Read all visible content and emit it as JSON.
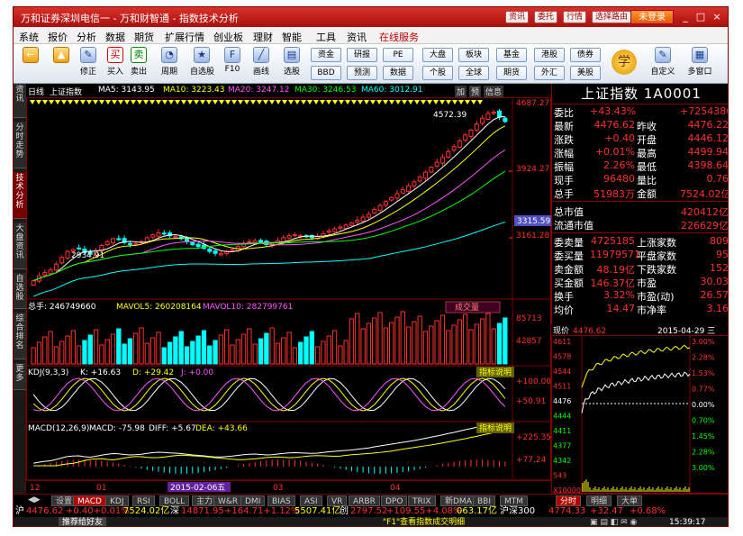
{
  "window": {
    "title": "万和证券深圳电信一 - 万和财智通 - 指数技术分析",
    "title_buttons": [
      "资讯",
      "委托",
      "行情",
      "选择路由"
    ],
    "login_button": "未登录",
    "controls": [
      "_",
      "□",
      "×"
    ]
  },
  "menu": [
    "系统",
    "报价",
    "分析",
    "数据",
    "期货",
    "扩展行情",
    "创业板",
    "理财",
    "智能",
    "工具",
    "资讯",
    "在线服务"
  ],
  "toolbar": {
    "tools": [
      {
        "label": "",
        "icon": "←"
      },
      {
        "label": "",
        "icon": "▲"
      },
      {
        "label": "修正",
        "icon": "✎"
      },
      {
        "label": "买入",
        "icon": "买"
      },
      {
        "label": "卖出",
        "icon": "卖"
      },
      {
        "label": "周期",
        "icon": "◔"
      },
      {
        "label": "自选股",
        "icon": "★"
      },
      {
        "label": "F10",
        "icon": "F"
      },
      {
        "label": "画线",
        "icon": "╱"
      },
      {
        "label": "选股",
        "icon": "▤"
      }
    ],
    "small_buttons": [
      [
        "资金",
        "BBD"
      ],
      [
        "研报",
        "预测"
      ],
      [
        "PE",
        "数据"
      ],
      [
        "大盘",
        "个股"
      ],
      [
        "板块",
        "全球"
      ],
      [
        "基金",
        "期货"
      ],
      [
        "港股",
        "外汇"
      ],
      [
        "债券",
        "美股"
      ]
    ],
    "study_label": "学",
    "custom_label": "自定义",
    "multiwin_label": "多窗口"
  },
  "left_tabs": [
    "资讯",
    "分时走势",
    "技术分析",
    "大盘资讯",
    "自选股",
    "综合排名",
    "更多"
  ],
  "left_tabs_active": 2,
  "main_info": {
    "period": "日线",
    "name": "上证指数",
    "ma5": "MA5: 3143.95",
    "ma10": "MA10: 3223.43",
    "ma20": "MA20: 3247.12",
    "ma30": "MA30: 3246.53",
    "ma60": "MA60: 3012.91",
    "buttons": [
      "加",
      "预",
      "信息"
    ],
    "high_label": "4572.39",
    "low_label": "2934.91"
  },
  "volume_info": {
    "total": "总手: 246749660",
    "mavol5": "MAVOL5: 260208164",
    "mavol10": "MAVOL10: 282799761",
    "button": "成交量"
  },
  "kdj_info": {
    "name": "KDJ(9,3,3)",
    "k": "K: +16.63",
    "d": "D: +29.42",
    "j": "J: +0.00",
    "button": "指标说明"
  },
  "macd_info": {
    "name": "MACD(12,26,9)",
    "macd": "MACD: -75.98",
    "diff": "DIFF: +5.67",
    "dea": "DEA: +43.66",
    "button": "指标说明"
  },
  "axis": {
    "price": [
      "4687.27",
      "3924.27",
      "3161.28"
    ],
    "cursor": "3315.59",
    "volume": [
      "85713",
      "42857"
    ],
    "kdj": [
      "+100.00",
      "+50.91"
    ],
    "macd": [
      "+225.35",
      "+77.24"
    ],
    "x_labels": [
      "12",
      "01",
      "2015-02-06五",
      "03",
      "04"
    ]
  },
  "chart_data": {
    "type": "candlestick",
    "title": "上证指数",
    "x_ticks": [
      "12",
      "01",
      "2015-02-06五",
      "03",
      "04"
    ],
    "ylim": [
      2700,
      4687.27
    ],
    "y_ticks": [
      4687.27,
      3924.27,
      3161.28
    ],
    "low_marker": 2934.91,
    "high_marker": 4572.39,
    "cursor_value": 3315.59,
    "close_series": [
      2850,
      2900,
      2934.91,
      2960,
      3020,
      3090,
      3150,
      3170,
      3180,
      3140,
      3120,
      3160,
      3210,
      3250,
      3280,
      3270,
      3240,
      3220,
      3230,
      3250,
      3290,
      3320,
      3340,
      3330,
      3310,
      3300,
      3280,
      3250,
      3220,
      3200,
      3180,
      3150,
      3130,
      3130,
      3150,
      3170,
      3200,
      3230,
      3250,
      3260,
      3240,
      3220,
      3230,
      3260,
      3290,
      3310,
      3320,
      3310,
      3300,
      3290,
      3300,
      3330,
      3360,
      3380,
      3400,
      3420,
      3440,
      3470,
      3500,
      3530,
      3580,
      3620,
      3660,
      3700,
      3740,
      3780,
      3820,
      3860,
      3910,
      3960,
      4010,
      4060,
      4110,
      4170,
      4220,
      4280,
      4340,
      4390,
      4450,
      4510,
      4560,
      4572.39,
      4520,
      4476.62
    ]
  },
  "quote": {
    "title": "上证指数 1A0001",
    "rows": [
      [
        "委比",
        "+43.43%",
        "",
        "+7254386"
      ],
      [
        "最新",
        "4476.62",
        "昨收",
        "4476.22"
      ],
      [
        "涨跌",
        "+0.40",
        "开盘",
        "4446.12"
      ],
      [
        "涨幅",
        "+0.01%",
        "最高",
        "4499.94"
      ],
      [
        "振幅",
        "2.26%",
        "最低",
        "4398.64"
      ],
      [
        "现手",
        "96480",
        "量比",
        "0.76"
      ],
      [
        "总手",
        "51983万",
        "金额",
        "7524.02亿"
      ]
    ],
    "cap_rows": [
      [
        "总市值",
        "",
        "",
        "420412亿"
      ],
      [
        "流通市值",
        "",
        "",
        "226629亿"
      ]
    ],
    "stat_rows": [
      [
        "委卖量",
        "4725185",
        "上涨家数",
        "809"
      ],
      [
        "委买量",
        "11979571",
        "平盘家数",
        "95"
      ],
      [
        "卖金额",
        "48.19亿",
        "下跌家数",
        "152"
      ],
      [
        "买金额",
        "146.37亿",
        "市盈",
        "30.03"
      ],
      [
        "换手",
        "3.32%",
        "市盈(动)",
        "26.57"
      ],
      [
        "均价",
        "14.47",
        "市净率",
        "3.16"
      ]
    ]
  },
  "mini_chart": {
    "label": "现价",
    "price": "4476.62",
    "date": "2015-04-29 三",
    "left_ticks": [
      "4611",
      "4578",
      "4544",
      "4511",
      "4476",
      "4444",
      "4411",
      "4377",
      "4342",
      "543",
      "X10000"
    ],
    "right_ticks": [
      "3.00%",
      "2.28%",
      "1.53%",
      "0.77%",
      "0.00%",
      "0.70%",
      "1.45%",
      "2.28%",
      "3.00%"
    ]
  },
  "bottom_tabs": [
    "设置",
    "MACD",
    "KDJ",
    "RSI",
    "BOLL",
    "主力",
    "W&R",
    "DMI",
    "BIAS",
    "ASI",
    "VR",
    "ARBR",
    "DPO",
    "TRIX",
    "新DMA",
    "BBI",
    "MTM"
  ],
  "bottom_tabs_active": 1,
  "right_tabs": [
    "分时",
    "明细",
    "大单"
  ],
  "ticker": {
    "sh_label": "沪",
    "sh": "4476.62",
    "sh_chg": "+0.40+0.01%",
    "sh_amt": "7524.02亿",
    "sz_label": "深",
    "sz": "14871.95",
    "sz_chg": "+164.71+1.12%",
    "sz_amt": "5507.41亿",
    "cy_label": "创",
    "cy": "2797.52",
    "cy_chg": "+109.55+4.08%",
    "cy_amt": "063.17亿",
    "hs_label": "沪深300",
    "hs": "4774.33",
    "hs_chg": "+32.47",
    "hs_pct": "+0.68%"
  },
  "status": {
    "recommend": "推荐给好友",
    "hint": "\"F1\"查看指数成交明细",
    "time": "15:39:17"
  },
  "colors": {
    "up": "#ff3030",
    "down": "#00ffff",
    "yellow": "#ffff00",
    "white": "#ffffff",
    "frame": "#800000"
  }
}
